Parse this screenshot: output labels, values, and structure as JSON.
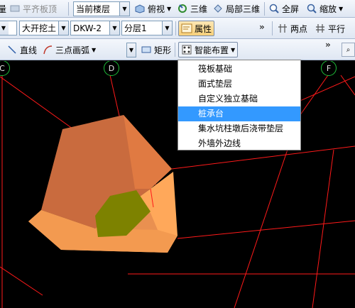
{
  "toolbar1": {
    "partial_left": "量",
    "flat_slab_top": "平齐板顶",
    "floor_combo": "当前楼层",
    "view_top": "俯视",
    "view_3d": "三维",
    "view_local_3d": "局部三维",
    "fullscreen": "全屏",
    "zoom": "缩放"
  },
  "toolbar2": {
    "combo_type": "大开挖土",
    "combo_code": "DKW-2",
    "combo_layer": "分层1",
    "properties": "属性",
    "two_points": "两点",
    "parallel": "平行"
  },
  "toolbar3": {
    "line": "直线",
    "arc": "三点画弧",
    "rect": "矩形",
    "smart_layout": "智能布置"
  },
  "axis": {
    "c": "C",
    "d": "D",
    "f": "F"
  },
  "menu": {
    "items": [
      "筏板基础",
      "面式垫层",
      "自定义独立基础",
      "桩承台",
      "集水坑柱墩后浇带垫层",
      "外墙外边线"
    ],
    "selected_index": 3
  },
  "colors": {
    "grid_line": "#ff1a1a",
    "axis_circle": "#1fbf3a",
    "menu_highlight": "#3399ff",
    "solid_dark": "#c96b3e",
    "solid_light": "#ffa85a",
    "solid_bottom": "#7d8200"
  }
}
